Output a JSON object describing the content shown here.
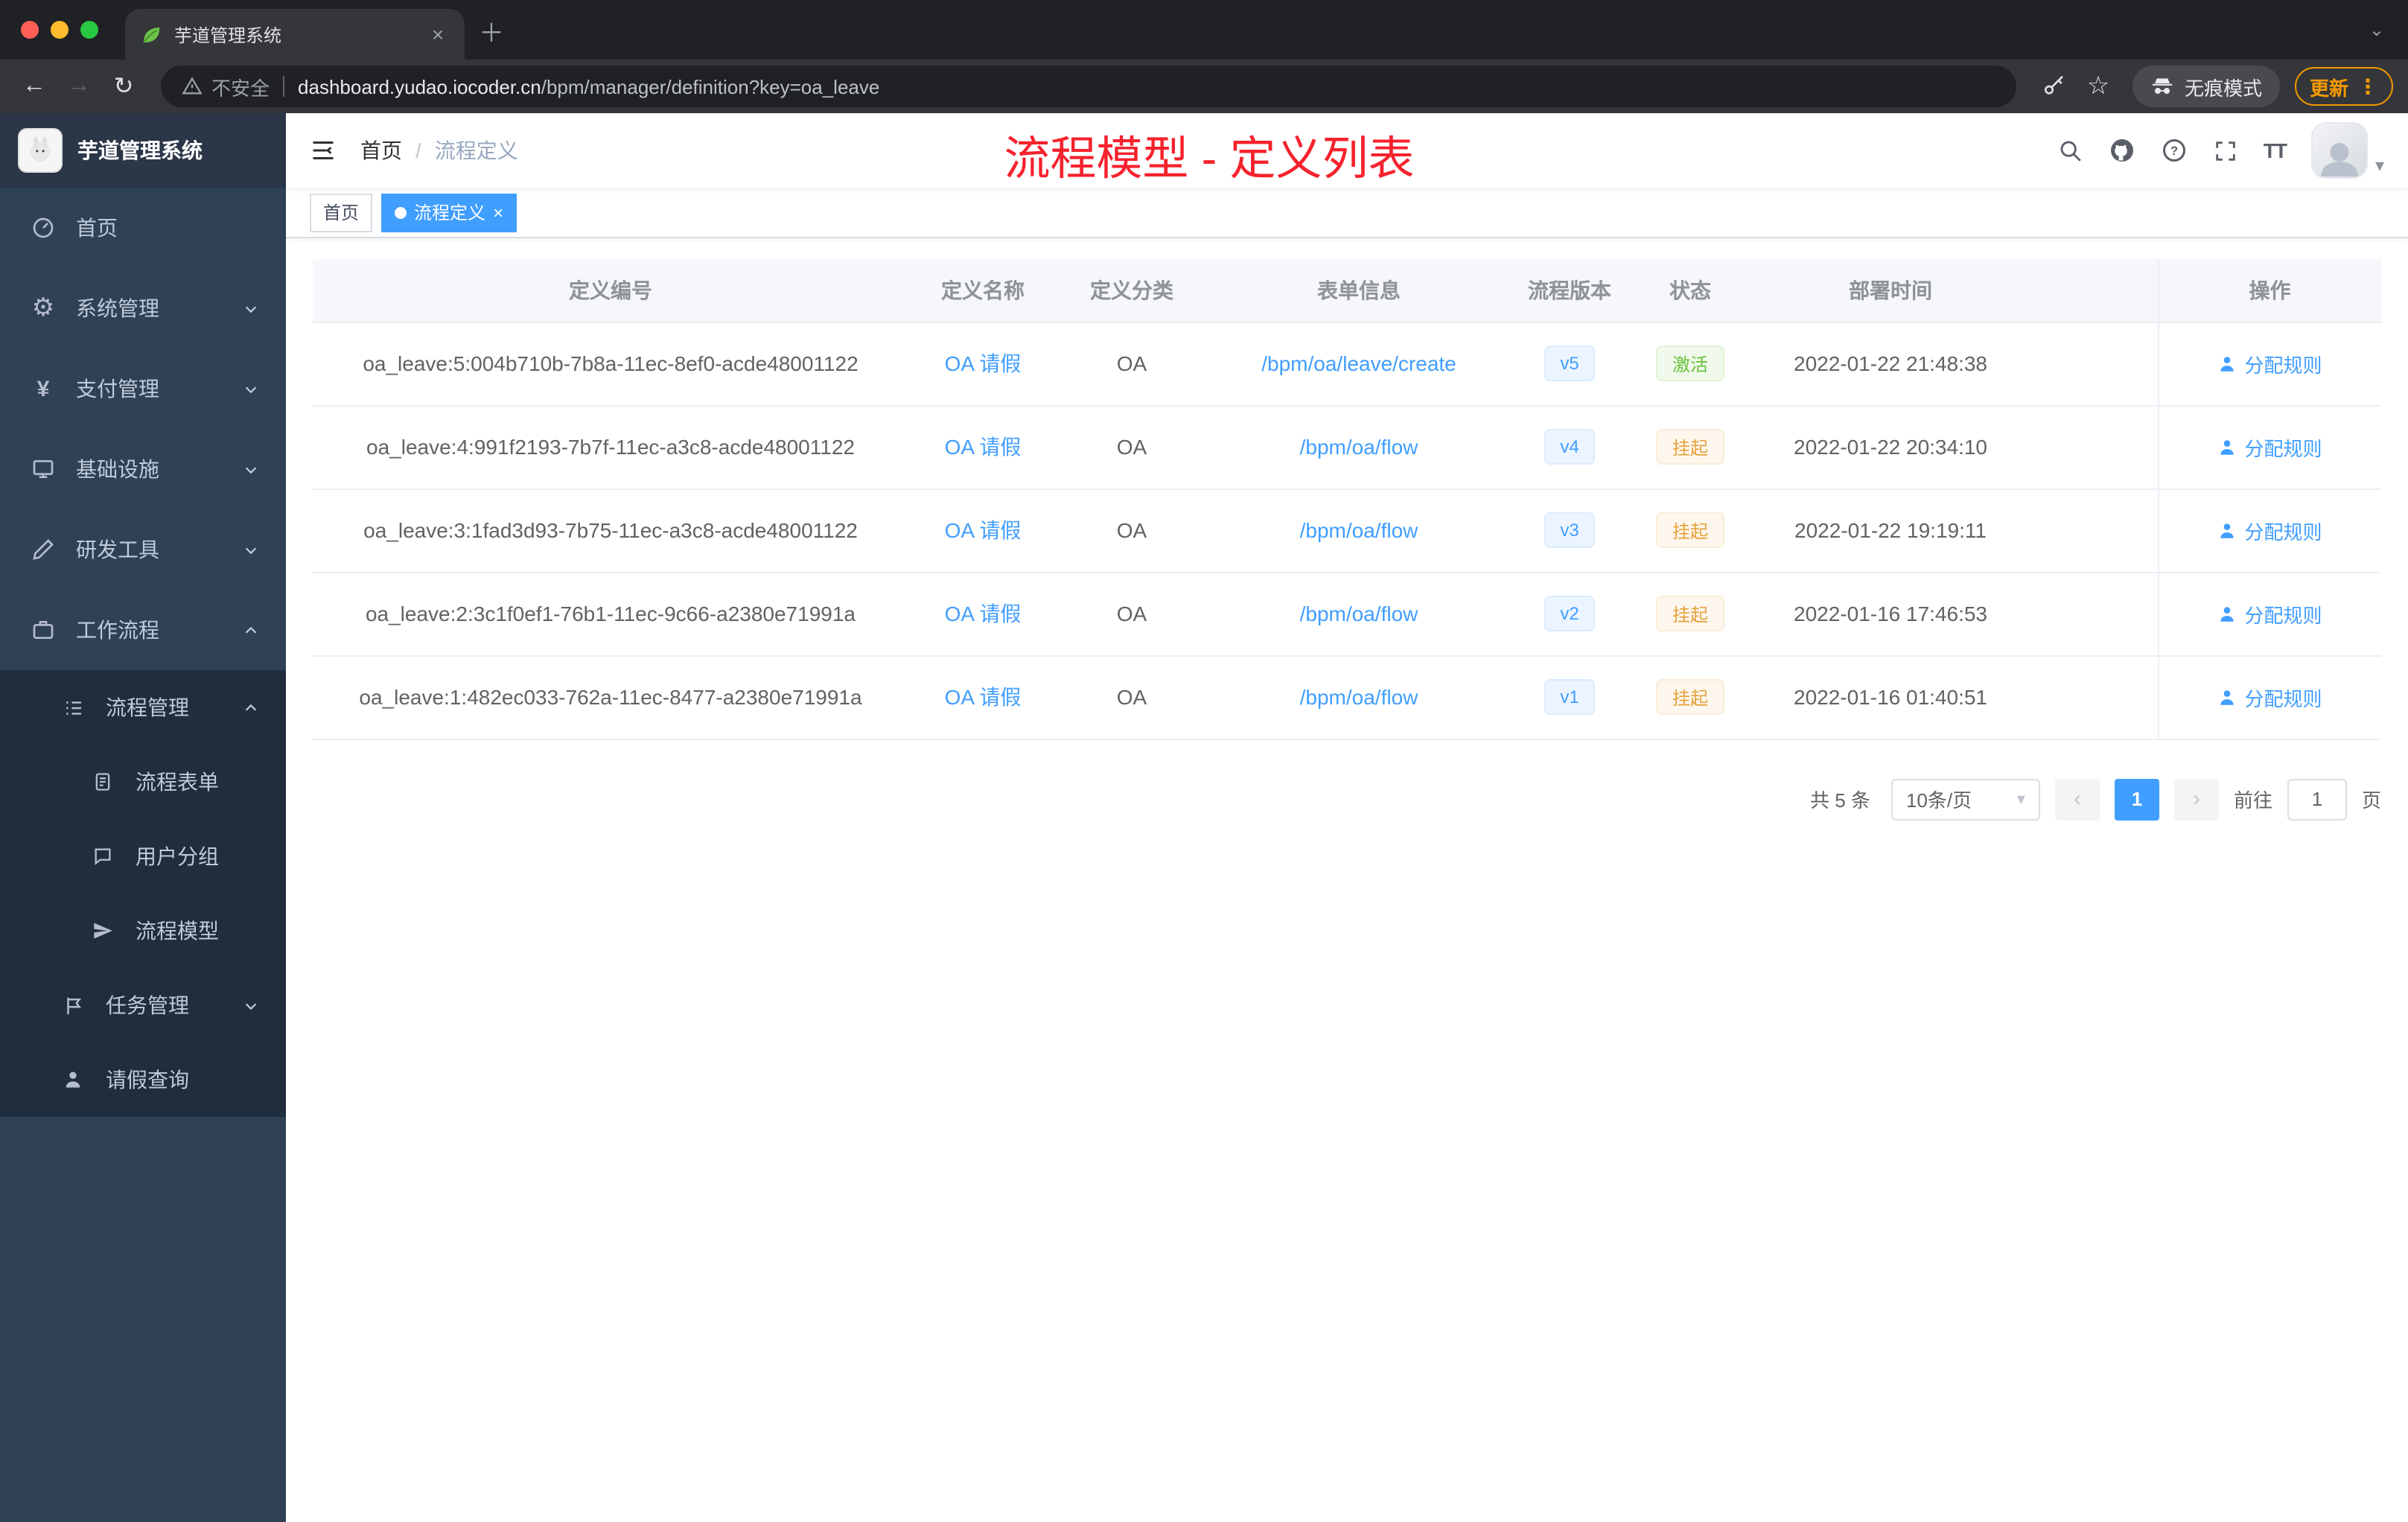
{
  "browser": {
    "tab_title": "芋道管理系统",
    "security_label": "不安全",
    "url_host": "dashboard.yudao.iocoder.cn",
    "url_path": "/bpm/manager/definition?key=oa_leave",
    "incognito_label": "无痕模式",
    "update_label": "更新"
  },
  "icons": {
    "close": "×",
    "plus": "＋",
    "more_vertical": "⋮",
    "caret_down": "▾",
    "chevron_down_small": "⌄",
    "chevron_left": "‹",
    "chevron_right": "›",
    "back": "←",
    "forward": "→",
    "reload": "↻",
    "star": "☆",
    "gear": "⚙",
    "yen": "¥",
    "question": "?",
    "font_size": "TT"
  },
  "sidebar": {
    "logo_title": "芋道管理系统",
    "items": [
      {
        "label": "首页",
        "icon": "dashboard-icon"
      },
      {
        "label": "系统管理",
        "icon": "gear-icon",
        "chevron": "down"
      },
      {
        "label": "支付管理",
        "icon": "yen-icon",
        "chevron": "down"
      },
      {
        "label": "基础设施",
        "icon": "infrastructure-icon",
        "chevron": "down"
      },
      {
        "label": "研发工具",
        "icon": "dev-tools-icon",
        "chevron": "down"
      },
      {
        "label": "工作流程",
        "icon": "workflow-icon",
        "chevron": "up"
      },
      {
        "label": "流程管理",
        "icon": "process-manage-icon",
        "chevron": "up"
      },
      {
        "label": "流程表单",
        "icon": "process-form-icon"
      },
      {
        "label": "用户分组",
        "icon": "user-group-icon"
      },
      {
        "label": "流程模型",
        "icon": "process-model-icon"
      },
      {
        "label": "任务管理",
        "icon": "task-manage-icon",
        "chevron": "down"
      },
      {
        "label": "请假查询",
        "icon": "leave-query-icon"
      }
    ]
  },
  "header": {
    "breadcrumb": {
      "home": "首页",
      "separator": "/",
      "current": "流程定义"
    },
    "annotation": "流程模型 - 定义列表"
  },
  "tags": {
    "home": "首页",
    "active": "流程定义"
  },
  "table": {
    "columns": [
      "定义编号",
      "定义名称",
      "定义分类",
      "表单信息",
      "流程版本",
      "状态",
      "部署时间",
      "操作"
    ],
    "rows": [
      {
        "id": "oa_leave:5:004b710b-7b8a-11ec-8ef0-acde48001122",
        "name": "OA 请假",
        "category": "OA",
        "form": "/bpm/oa/leave/create",
        "version": "v5",
        "status": "激活",
        "status_class": "el-tag tag-success",
        "time": "2022-01-22 21:48:38",
        "action": "分配规则"
      },
      {
        "id": "oa_leave:4:991f2193-7b7f-11ec-a3c8-acde48001122",
        "name": "OA 请假",
        "category": "OA",
        "form": "/bpm/oa/flow",
        "version": "v4",
        "status": "挂起",
        "status_class": "el-tag tag-warning",
        "time": "2022-01-22 20:34:10",
        "action": "分配规则"
      },
      {
        "id": "oa_leave:3:1fad3d93-7b75-11ec-a3c8-acde48001122",
        "name": "OA 请假",
        "category": "OA",
        "form": "/bpm/oa/flow",
        "version": "v3",
        "status": "挂起",
        "status_class": "el-tag tag-warning",
        "time": "2022-01-22 19:19:11",
        "action": "分配规则"
      },
      {
        "id": "oa_leave:2:3c1f0ef1-76b1-11ec-9c66-a2380e71991a",
        "name": "OA 请假",
        "category": "OA",
        "form": "/bpm/oa/flow",
        "version": "v2",
        "status": "挂起",
        "status_class": "el-tag tag-warning",
        "time": "2022-01-16 17:46:53",
        "action": "分配规则"
      },
      {
        "id": "oa_leave:1:482ec033-762a-11ec-8477-a2380e71991a",
        "name": "OA 请假",
        "category": "OA",
        "form": "/bpm/oa/flow",
        "version": "v1",
        "status": "挂起",
        "status_class": "el-tag tag-warning",
        "time": "2022-01-16 01:40:51",
        "action": "分配规则"
      }
    ]
  },
  "pagination": {
    "total": "共 5 条",
    "page_size": "10条/页",
    "page": "1",
    "goto_label": "前往",
    "goto_value": "1",
    "unit": "页"
  },
  "colors": {
    "accent_blue": "#409eff",
    "success_green": "#67c23a",
    "warning_orange": "#e6a23c",
    "annotation_red": "#f5222d",
    "sidebar_bg": "#304156",
    "submenu_bg": "#1f2d3d"
  }
}
